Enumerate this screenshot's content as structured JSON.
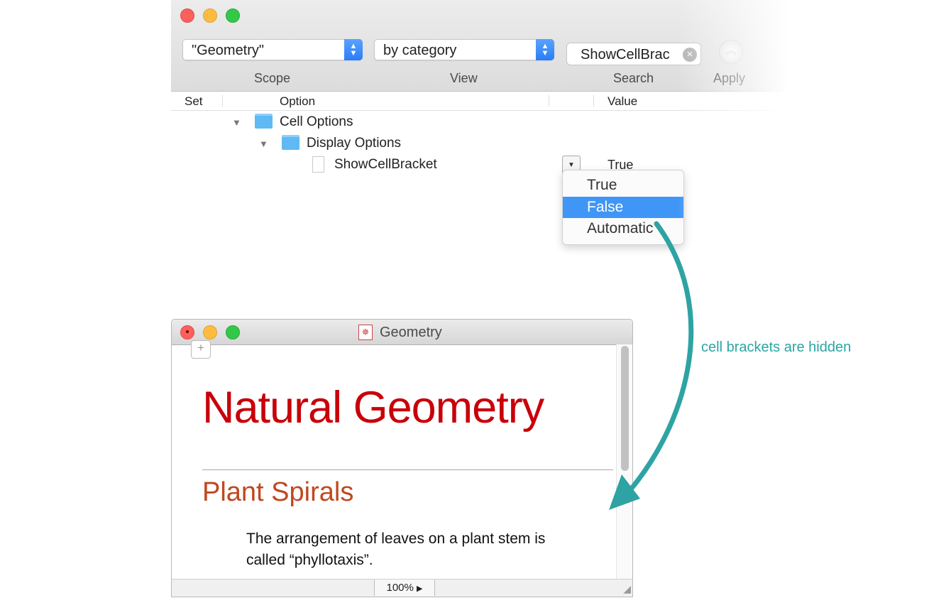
{
  "inspector": {
    "scope": {
      "label": "Scope",
      "value": "\"Geometry\""
    },
    "view": {
      "label": "View",
      "value": "by category"
    },
    "search": {
      "label": "Search",
      "value": "ShowCellBrac"
    },
    "apply": {
      "label": "Apply"
    },
    "columns": {
      "set": "Set",
      "option": "Option",
      "value": "Value"
    },
    "tree": [
      {
        "label": "Cell Options"
      },
      {
        "label": "Display Options"
      },
      {
        "label": "ShowCellBracket",
        "value": "True"
      }
    ],
    "menu": {
      "items": [
        "True",
        "False",
        "Automatic"
      ],
      "selected": "False"
    }
  },
  "notebook": {
    "window_title": "Geometry",
    "title": "Natural Geometry",
    "section": "Plant Spirals",
    "text": "The arrangement of leaves on a plant stem is called “phyllotaxis”.",
    "zoom": "100%"
  },
  "annotation": {
    "text": "cell brackets are hidden",
    "color": "#28a6a6"
  },
  "colors": {
    "accent": "#3f96f7",
    "title_red": "#c8000a",
    "section_orange": "#c0481f"
  }
}
